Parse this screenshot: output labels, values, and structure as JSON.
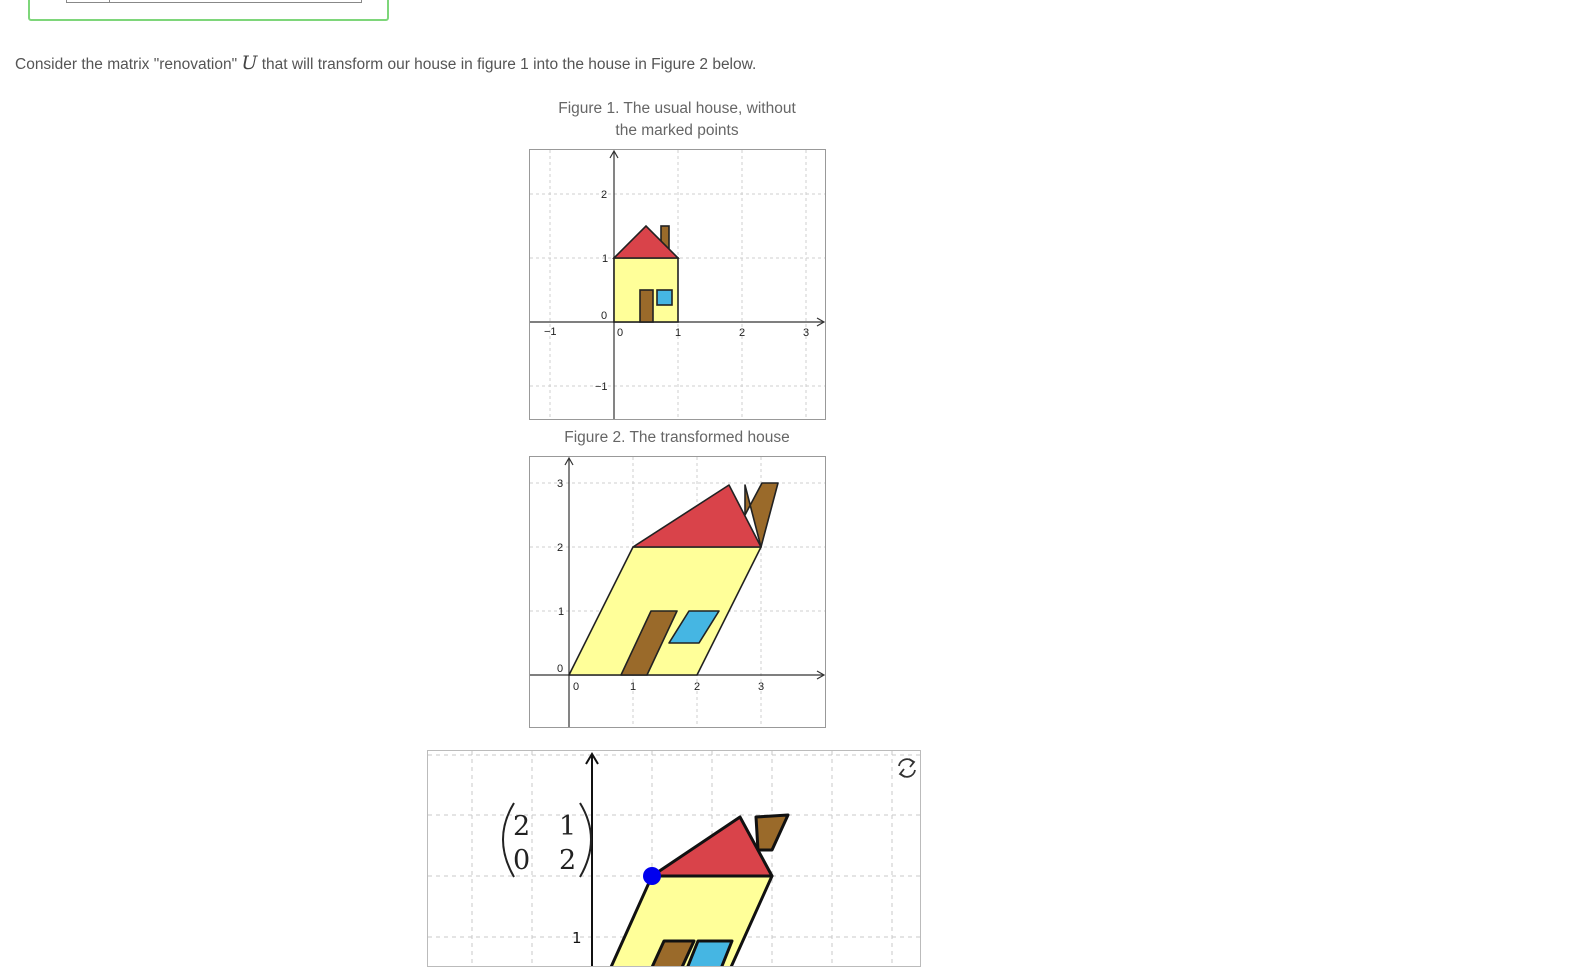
{
  "intro": {
    "before": "Consider the matrix \"renovation\" ",
    "symbol": "U",
    "after": " that will transform our house in figure 1 into the house in Figure 2 below."
  },
  "figure1": {
    "caption_line1": "Figure 1. The usual house, without",
    "caption_line2": "the marked points",
    "x_ticks": [
      "−1",
      "0",
      "1",
      "2",
      "3"
    ],
    "y_ticks": [
      "2",
      "1",
      "0",
      "−1"
    ]
  },
  "figure2": {
    "caption": "Figure 2. The transformed house",
    "x_ticks": [
      "0",
      "1",
      "2",
      "3"
    ],
    "y_ticks": [
      "3",
      "2",
      "1",
      "0"
    ]
  },
  "applet": {
    "matrix": [
      "2",
      "1",
      "0",
      "2"
    ],
    "y_tick": "1",
    "reset_icon": "refresh-icon"
  },
  "colors": {
    "roof": "#d9434a",
    "wall": "#ffff99",
    "door": "#9a6a2a",
    "window": "#45b6e3",
    "chimney": "#9a6a2a",
    "point": "#0000ee",
    "frame_green": "#7ed67a"
  }
}
